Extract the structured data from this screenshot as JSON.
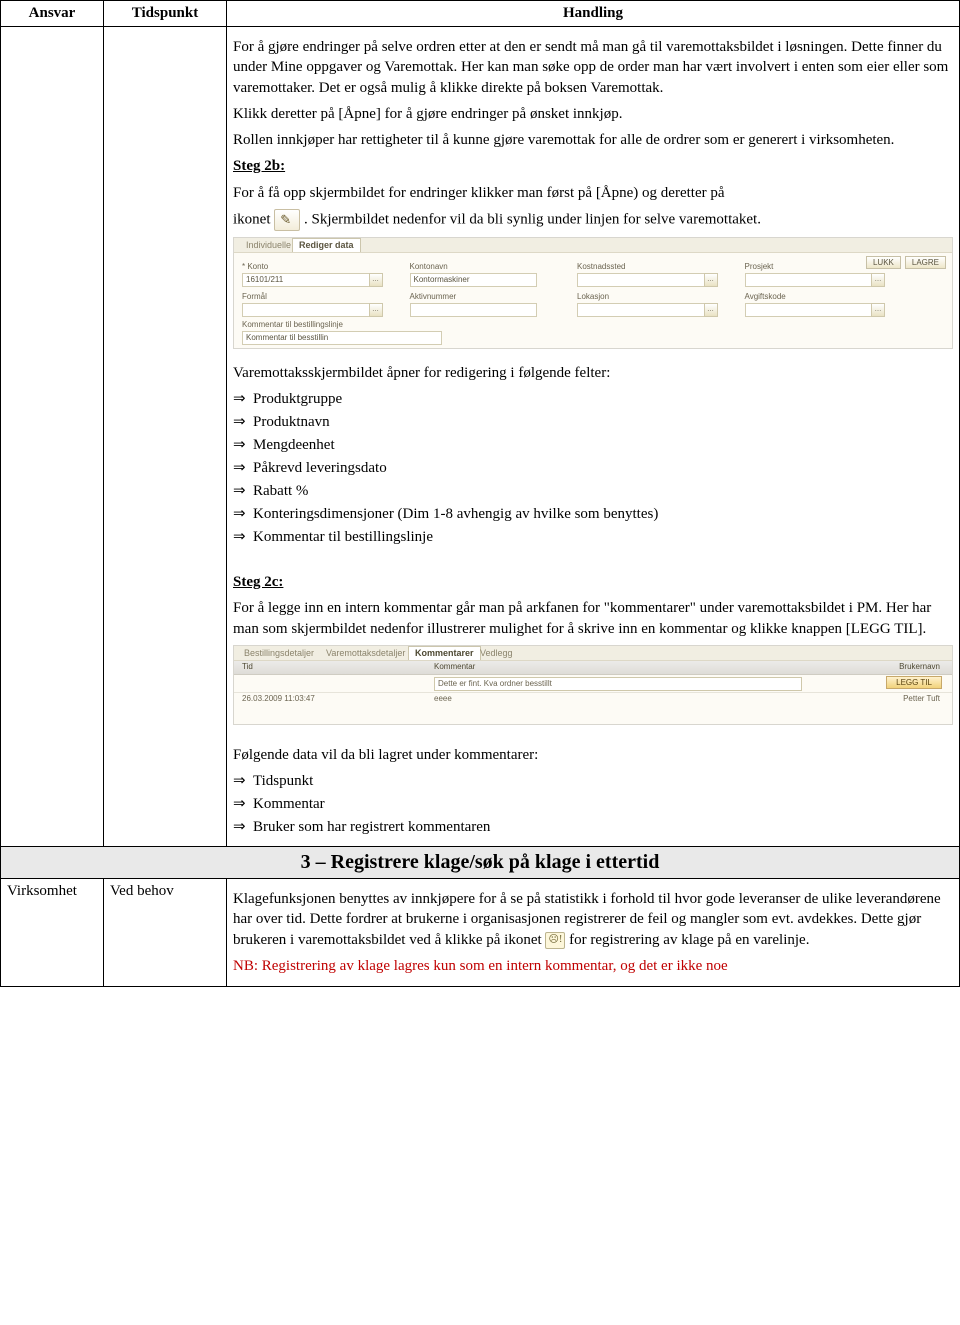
{
  "headers": {
    "ansvar": "Ansvar",
    "tidspunkt": "Tidspunkt",
    "handling": "Handling"
  },
  "row1": {
    "p1": "For å gjøre endringer på selve ordren etter at den er sendt må man gå til varemottaksbildet i løsningen. Dette finner du under Mine oppgaver og Varemottak. Her kan man søke opp de order man har vært involvert i enten som eier eller som varemottaker. Det er også mulig å klikke direkte på boksen Varemottak.",
    "p2": "Klikk deretter på [Åpne] for å gjøre endringer på ønsket innkjøp.",
    "p3": "Rollen innkjøper har rettigheter til å kunne gjøre varemottak for alle de ordrer som er generert i virksomheten.",
    "step2b_label": "Steg 2b:",
    "step2b_p1a": "For å få opp skjermbildet for endringer klikker man først på [Åpne) og deretter på",
    "step2b_p1b": "ikonet ",
    "step2b_p1c": ". Skjermbildet nedenfor vil da bli synlig under linjen for selve varemottaket.",
    "shot1": {
      "tab_inactive": "Individuelle varer",
      "tab_active": "Rediger data",
      "btn_lukk": "LUKK",
      "btn_lagre": "LAGRE",
      "fields": {
        "konto_label": "* Konto",
        "konto_value": "16101/211",
        "konstnavn": "Kontonavn",
        "konstnavn_value": "Kontormaskiner",
        "kostnadssted": "Kostnadssted",
        "prosjekt": "Prosjekt",
        "formal": "Formål",
        "aktivnummer": "Aktivnummer",
        "lokasjon": "Lokasjon",
        "avgiftskode": "Avgiftskode",
        "kommentar": "Kommentar til bestillingslinje",
        "kommentar_value": "Kommentar til besstillin"
      }
    },
    "fields_intro": "Varemottaksskjermbildet åpner for redigering i følgende felter:",
    "fields_list": [
      "Produktgruppe",
      "Produktnavn",
      "Mengdeenhet",
      "Påkrevd leveringsdato",
      "Rabatt %",
      "Konteringsdimensjoner (Dim 1-8 avhengig av hvilke som benyttes)",
      "Kommentar til bestillingslinje"
    ],
    "step2c_label": "Steg 2c:",
    "step2c_p1": "For å legge inn en intern kommentar går man på arkfanen for \"kommentarer\" under varemottaksbildet i PM. Her har man som skjermbildet nedenfor illustrerer mulighet for å skrive inn en kommentar og klikke knappen [LEGG TIL].",
    "shot2": {
      "tab1": "Bestillingsdetaljer",
      "tab2": "Varemottaksdetaljer",
      "tab3": "Kommentarer",
      "tab4": "Vedlegg",
      "hdr_tid": "Tid",
      "hdr_kommentar": "Kommentar",
      "hdr_brukernavn": "Brukernavn",
      "btn_add": "LEGG TIL",
      "input_value": "Dette er fint. Kva ordner besstillt",
      "ts": "26.03.2009 11:03:47",
      "existing_comment": "eeee",
      "user": "Petter Tuft"
    },
    "stored_intro": "Følgende data vil da bli lagret under kommentarer:",
    "stored_list": [
      "Tidspunkt",
      "Kommentar",
      "Bruker som har registrert kommentaren"
    ]
  },
  "section3_title": "3 – Registrere klage/søk på klage i ettertid",
  "row3": {
    "ansvar": "Virksomhet",
    "tidspunkt": "Ved behov",
    "p1a": "Klagefunksjonen benyttes av innkjøpere for å se på statistikk i forhold til hvor gode leveranser de ulike leverandørene har over tid. Dette fordrer at brukerne i organisasjonen registrerer de feil og mangler som evt. avdekkes. Dette gjør brukeren i varemottaksbildet ved å klikke på ikonet ",
    "p1b": " for registrering av klage på en varelinje.",
    "nb": "NB: Registrering av klage lagres kun som en intern kommentar, og det er ikke noe"
  }
}
